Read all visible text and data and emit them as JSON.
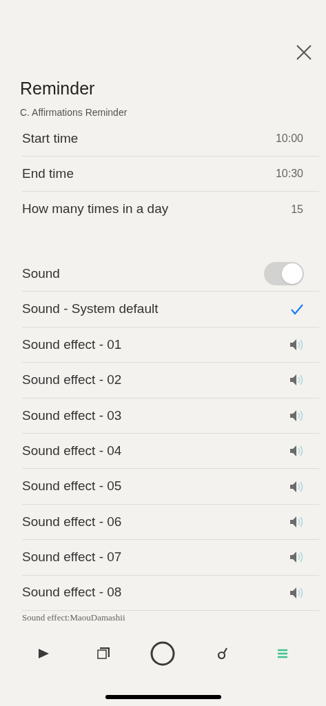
{
  "title": "Reminder",
  "subtitle": "C. Affirmations Reminder",
  "settings": [
    {
      "label": "Start time",
      "value": "10:00"
    },
    {
      "label": "End time",
      "value": "10:30"
    },
    {
      "label": "How many times in a day",
      "value": "15"
    }
  ],
  "sounds": [
    {
      "kind": "toggle",
      "label": "Sound",
      "on": true
    },
    {
      "kind": "option",
      "label": "Sound - System default",
      "selected": true
    },
    {
      "kind": "effect",
      "label": "Sound effect - 01",
      "selected": false
    },
    {
      "kind": "effect",
      "label": "Sound effect - 02",
      "selected": false
    },
    {
      "kind": "effect",
      "label": "Sound effect - 03",
      "selected": false
    },
    {
      "kind": "effect",
      "label": "Sound effect - 04",
      "selected": false
    },
    {
      "kind": "effect",
      "label": "Sound effect - 05",
      "selected": false
    },
    {
      "kind": "effect",
      "label": "Sound effect - 06",
      "selected": false
    },
    {
      "kind": "effect",
      "label": "Sound effect - 07",
      "selected": false
    },
    {
      "kind": "effect",
      "label": "Sound effect - 08",
      "selected": false
    }
  ],
  "credit": "Sound effect:MaouDamashii",
  "tabs": [
    {
      "kind": "play",
      "selected": false
    },
    {
      "kind": "square",
      "selected": false
    },
    {
      "kind": "circle",
      "selected": false
    },
    {
      "kind": "ring",
      "selected": false
    },
    {
      "kind": "menu",
      "selected": true
    }
  ]
}
